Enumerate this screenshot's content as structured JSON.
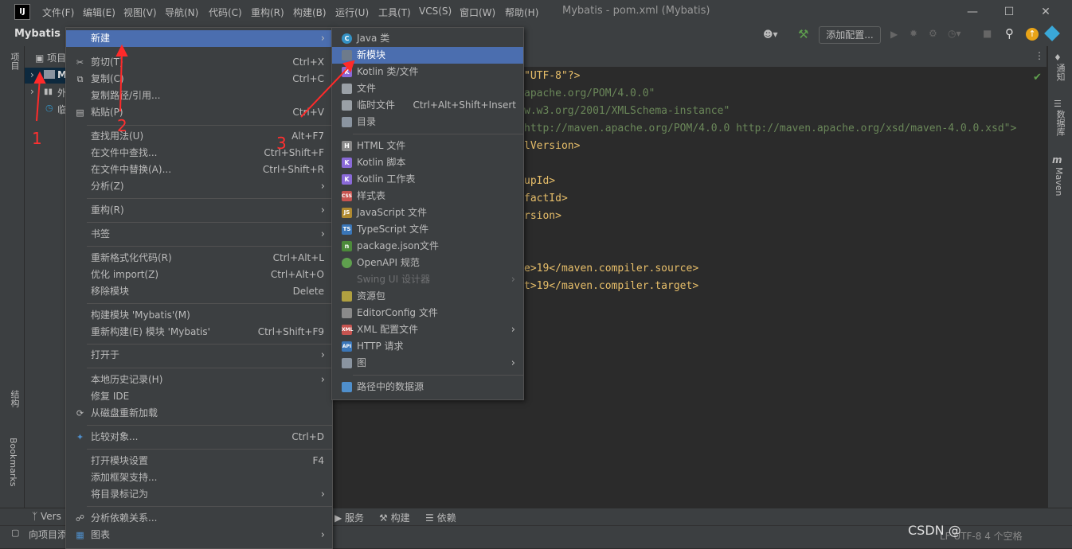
{
  "titlebar": {
    "menus": [
      "文件(F)",
      "编辑(E)",
      "视图(V)",
      "导航(N)",
      "代码(C)",
      "重构(R)",
      "构建(B)",
      "运行(U)",
      "工具(T)",
      "VCS(S)",
      "窗口(W)",
      "帮助(H)"
    ],
    "window_title": "Mybatis - pom.xml (Mybatis)"
  },
  "toolbar": {
    "project_breadcrumb": "Mybatis",
    "add_config_label": "添加配置..."
  },
  "left_stripe": {
    "project": "项目",
    "structure": "结构",
    "bookmarks": "Bookmarks"
  },
  "right_stripe": {
    "notifications": "通知",
    "database": "数据库",
    "maven": "Maven"
  },
  "project_panel": {
    "header": "项目",
    "items": [
      "M",
      "外",
      "临"
    ]
  },
  "editor": {
    "lines": [
      {
        "text": "\"UTF-8\"?>"
      },
      {
        "text": "apache.org/POM/4.0.0\""
      },
      {
        "text": "w.w3.org/2001/XMLSchema-instance\""
      },
      {
        "text": "http://maven.apache.org/POM/4.0.0 http://maven.apache.org/xsd/maven-4.0.0.xsd\">"
      },
      {
        "text": "lVersion>"
      },
      {
        "text": ""
      },
      {
        "text": "upId>"
      },
      {
        "text": "factId>"
      },
      {
        "text": "rsion>"
      },
      {
        "text": ""
      },
      {
        "text": ""
      },
      {
        "text": "e>19</maven.compiler.source>"
      },
      {
        "text": "t>19</maven.compiler.target>"
      }
    ]
  },
  "context_menu": {
    "items": [
      {
        "label": "新建",
        "shortcut": "",
        "submenu": true,
        "selected": true
      },
      {
        "label": "剪切(T)",
        "shortcut": "Ctrl+X",
        "icon": "scissors-icon"
      },
      {
        "label": "复制(C)",
        "shortcut": "Ctrl+C",
        "icon": "copy-icon"
      },
      {
        "label": "复制路径/引用...",
        "shortcut": ""
      },
      {
        "label": "粘贴(P)",
        "shortcut": "Ctrl+V",
        "icon": "paste-icon"
      },
      {
        "label": "查找用法(U)",
        "shortcut": "Alt+F7"
      },
      {
        "label": "在文件中查找...",
        "shortcut": "Ctrl+Shift+F"
      },
      {
        "label": "在文件中替换(A)...",
        "shortcut": "Ctrl+Shift+R"
      },
      {
        "label": "分析(Z)",
        "shortcut": "",
        "submenu": true
      },
      {
        "label": "重构(R)",
        "shortcut": "",
        "submenu": true
      },
      {
        "label": "书签",
        "shortcut": "",
        "submenu": true
      },
      {
        "label": "重新格式化代码(R)",
        "shortcut": "Ctrl+Alt+L"
      },
      {
        "label": "优化 import(Z)",
        "shortcut": "Ctrl+Alt+O"
      },
      {
        "label": "移除模块",
        "shortcut": "Delete"
      },
      {
        "label": "构建模块 'Mybatis'(M)",
        "shortcut": ""
      },
      {
        "label": "重新构建(E) 模块 'Mybatis'",
        "shortcut": "Ctrl+Shift+F9"
      },
      {
        "label": "打开于",
        "shortcut": "",
        "submenu": true
      },
      {
        "label": "本地历史记录(H)",
        "shortcut": "",
        "submenu": true
      },
      {
        "label": "修复 IDE",
        "shortcut": ""
      },
      {
        "label": "从磁盘重新加载",
        "shortcut": "",
        "icon": "reload-icon"
      },
      {
        "label": "比较对象...",
        "shortcut": "Ctrl+D",
        "icon": "compare-icon"
      },
      {
        "label": "打开模块设置",
        "shortcut": "F4"
      },
      {
        "label": "添加框架支持...",
        "shortcut": ""
      },
      {
        "label": "将目录标记为",
        "shortcut": "",
        "submenu": true
      },
      {
        "label": "分析依赖关系...",
        "shortcut": "",
        "icon": "dependency-icon"
      },
      {
        "label": "图表",
        "shortcut": "",
        "submenu": true,
        "icon": "diagram-icon"
      }
    ]
  },
  "submenu": {
    "items": [
      {
        "label": "Java 类",
        "icon_text": "C",
        "icon_color": "#3592c4"
      },
      {
        "label": "新模块",
        "icon_text": "",
        "icon_color": "#6e7b8b",
        "selected": true
      },
      {
        "label": "Kotlin 类/文件",
        "icon_text": "K",
        "icon_color": "#8a6ad8"
      },
      {
        "label": "文件",
        "icon_text": "",
        "icon_color": "#9aa0a6"
      },
      {
        "label": "临时文件",
        "shortcut": "Ctrl+Alt+Shift+Insert",
        "icon_text": "",
        "icon_color": "#9aa0a6"
      },
      {
        "label": "目录",
        "icon_text": "",
        "icon_color": "#8a94a0"
      },
      {
        "label": "HTML 文件",
        "icon_text": "H",
        "icon_color": "#8a8a8a"
      },
      {
        "label": "Kotlin 脚本",
        "icon_text": "K",
        "icon_color": "#8a6ad8"
      },
      {
        "label": "Kotlin 工作表",
        "icon_text": "K",
        "icon_color": "#8a6ad8"
      },
      {
        "label": "样式表",
        "icon_text": "CSS",
        "icon_color": "#c75450"
      },
      {
        "label": "JavaScript 文件",
        "icon_text": "JS",
        "icon_color": "#b08a30"
      },
      {
        "label": "TypeScript 文件",
        "icon_text": "TS",
        "icon_color": "#3a76b8"
      },
      {
        "label": "package.json文件",
        "icon_text": "n",
        "icon_color": "#4c8a3a"
      },
      {
        "label": "OpenAPI 规范",
        "icon_text": "",
        "icon_color": "#5fa04e"
      },
      {
        "label": "Swing UI 设计器",
        "icon_text": "",
        "icon_color": "#3c3f41",
        "disabled": true,
        "submenu": true
      },
      {
        "label": "资源包",
        "icon_text": "",
        "icon_color": "#b0a040"
      },
      {
        "label": "EditorConfig 文件",
        "icon_text": "",
        "icon_color": "#8a8a8a"
      },
      {
        "label": "XML 配置文件",
        "icon_text": "XML",
        "icon_color": "#c75450",
        "submenu": true
      },
      {
        "label": "HTTP 请求",
        "icon_text": "API",
        "icon_color": "#3a76b8"
      },
      {
        "label": "图",
        "icon_text": "",
        "icon_color": "#8a94a0",
        "submenu": true
      },
      {
        "label": "路径中的数据源",
        "icon_text": "",
        "icon_color": "#4f8fcc"
      }
    ]
  },
  "bottom_tabs": [
    "Vers",
    "服务",
    "构建",
    "依赖"
  ],
  "status": {
    "left": "向项目添",
    "right": "LF  UTF-8  4 个空格"
  },
  "annotations": [
    "1",
    "2",
    "3"
  ],
  "watermark": "CSDN @"
}
